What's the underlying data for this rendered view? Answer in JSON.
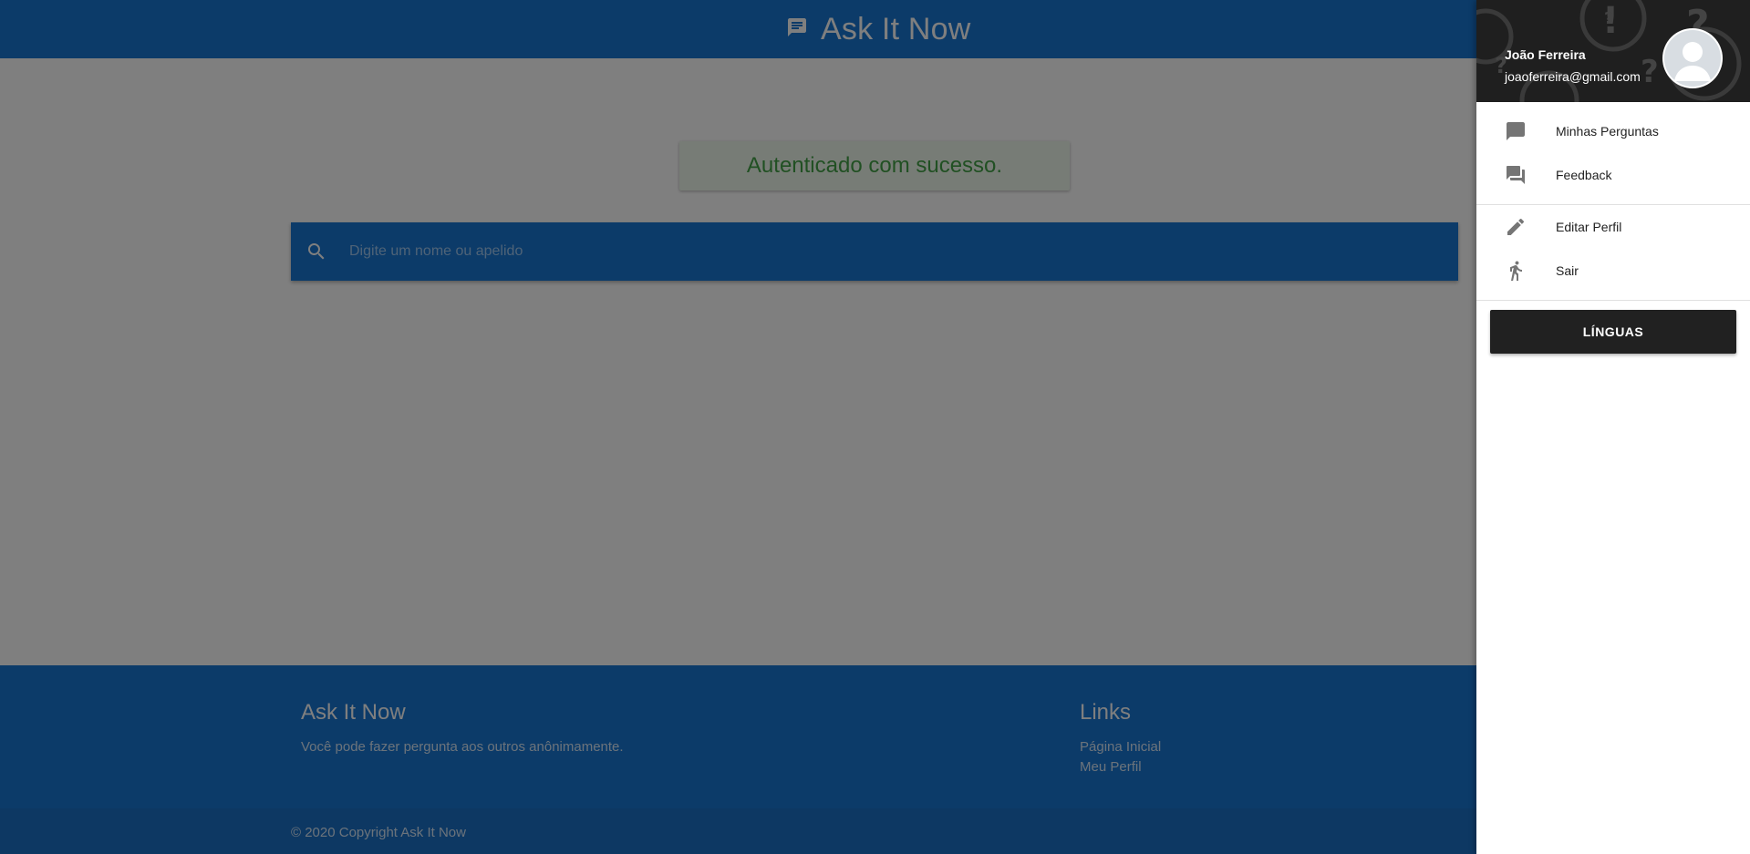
{
  "header": {
    "title": "Ask It Now",
    "icon": "chat-message-icon"
  },
  "toast": {
    "message": "Autenticado com sucesso."
  },
  "search": {
    "placeholder": "Digite um nome ou apelido",
    "value": "",
    "icon": "search-icon"
  },
  "footer": {
    "about_title": "Ask It Now",
    "about_text": "Você pode fazer pergunta aos outros anônimamente.",
    "links_title": "Links",
    "links": [
      "Página Inicial",
      "Meu Perfil"
    ],
    "copyright": "© 2020 Copyright Ask It Now"
  },
  "drawer": {
    "user": {
      "name": "João Ferreira",
      "email": "joaoferreira@gmail.com"
    },
    "items": [
      {
        "label": "Minhas Perguntas",
        "icon": "message-icon"
      },
      {
        "label": "Feedback",
        "icon": "forum-icon"
      },
      {
        "label": "Editar Perfil",
        "icon": "pencil-icon"
      },
      {
        "label": "Sair",
        "icon": "walk-icon"
      }
    ],
    "languages_button": "LÍNGUAS"
  },
  "colors": {
    "primary": "#1976d2",
    "toast_text": "#43a047",
    "drawer_header": "#1f1f1f",
    "button_dark": "#212121"
  }
}
